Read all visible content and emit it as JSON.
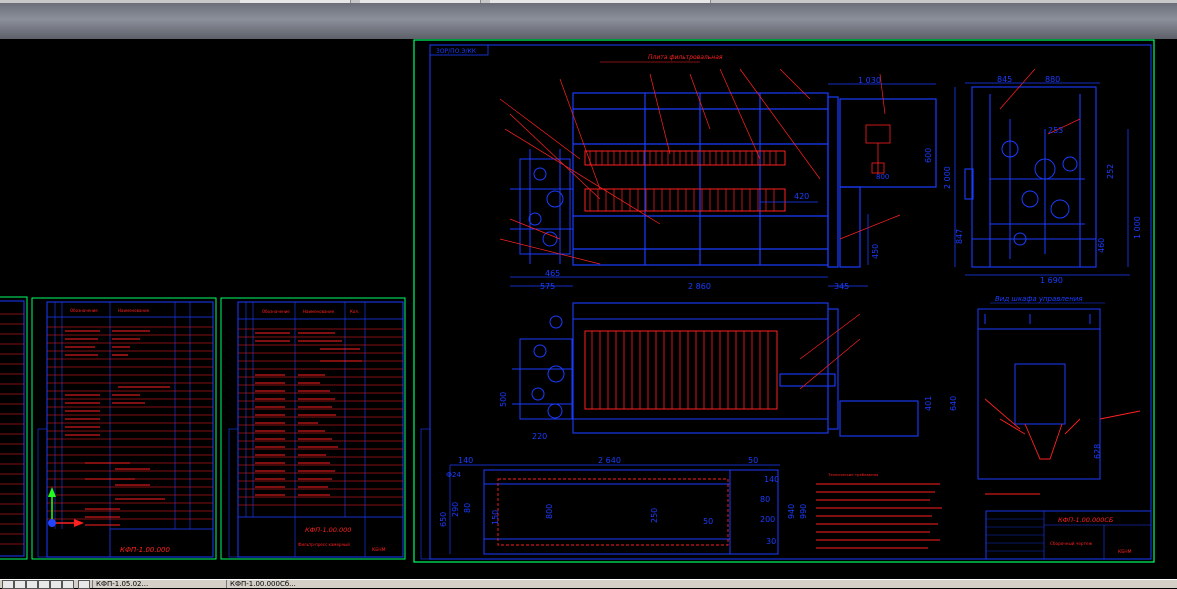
{
  "app": {
    "name": "CAD drawing viewer"
  },
  "colors": {
    "sheet_border": "#00ff66",
    "line_blue": "#1a3cff",
    "line_red": "#ff2020",
    "background": "#000000"
  },
  "main_sheet": {
    "corner_tag": "3ОР/ПО.Э/КК",
    "title_note": "Плита фильтровальная",
    "dims_top": [
      "1 030",
      "845",
      "880"
    ],
    "dims_right": [
      "600",
      "800",
      "2 000",
      "253",
      "252",
      "847",
      "1 000",
      "460",
      "1 690",
      "420",
      "450"
    ],
    "dims_bottom": [
      "465",
      "575",
      "2 860",
      "345"
    ],
    "section_label": "Вид шкафа управления",
    "dims_mid": [
      "500",
      "220",
      "640",
      "401",
      "628"
    ],
    "dims_lower": [
      "140",
      "2 640",
      "50",
      "140",
      "80",
      "200",
      "50",
      "30",
      "Ф24",
      "650",
      "290",
      "80",
      "150",
      "800",
      "250",
      "940",
      "990"
    ],
    "notes_title": "Технические требования",
    "title_block": {
      "code": "КФП-1.00.000СБ",
      "name": "Сборочный чертеж",
      "org": "КБНМ"
    }
  },
  "spec_sheet_1": {
    "code": "КФП-1.00.000",
    "headers": [
      "Обозначение",
      "Наименование"
    ]
  },
  "spec_sheet_2": {
    "code": "КФП-1.00.000",
    "name": "Фильтр-пресс камерный",
    "org": "КБНМ",
    "headers": [
      "Обозначение",
      "Наименование",
      "Кол."
    ]
  },
  "statusbar": {
    "tabs": [
      "КФП-1.05.02...",
      "КФП-1.00.000Сб..."
    ]
  }
}
